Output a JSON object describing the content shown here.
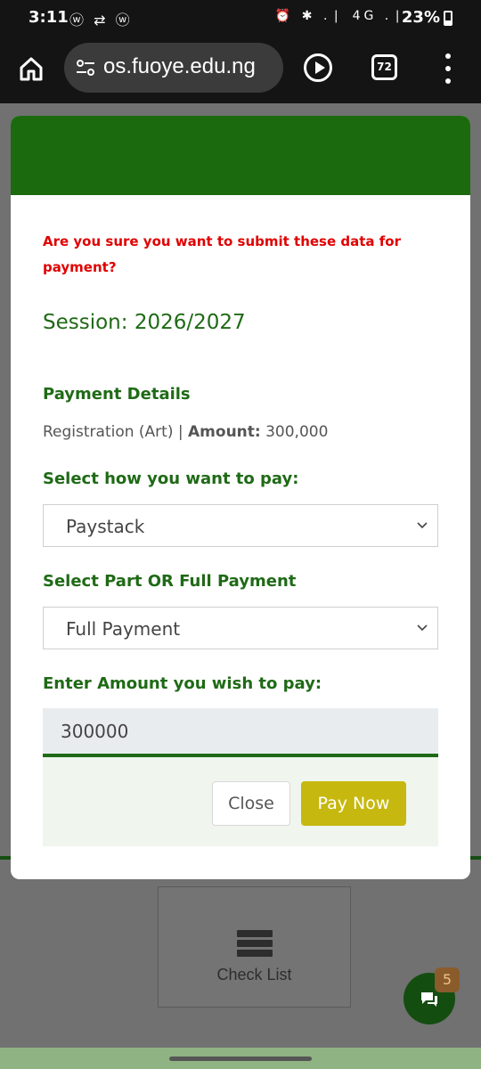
{
  "status_bar": {
    "time": "3:11",
    "left_icons": "ⓦ ⇄ ⓦ",
    "right_icons": "⏰ ✱ .❘ 4G .❘",
    "battery": "23%"
  },
  "browser": {
    "url": "os.fuoye.edu.ng",
    "tab_count": "72"
  },
  "modal": {
    "confirm_text": "Are you sure you want to submit these data for payment?",
    "session": "Session: 2026/2027",
    "details_heading": "Payment Details",
    "details_item": "Registration (Art) |",
    "amount_label": "Amount:",
    "amount_value": "300,000",
    "pay_method_label": "Select how you want to pay:",
    "pay_method_value": "Paystack",
    "part_full_label": "Select Part OR Full Payment",
    "part_full_value": "Full Payment",
    "amount_input_label": "Enter Amount you wish to pay:",
    "amount_input_value": "300000",
    "close_label": "Close",
    "pay_now_label": "Pay Now"
  },
  "background": {
    "checklist_label": "Check List",
    "chat_badge": "5"
  },
  "colors": {
    "header_green": "#1b6a0e",
    "label_green": "#1f6a16",
    "warning_red": "#e00000",
    "pay_button": "#c6b80f"
  }
}
